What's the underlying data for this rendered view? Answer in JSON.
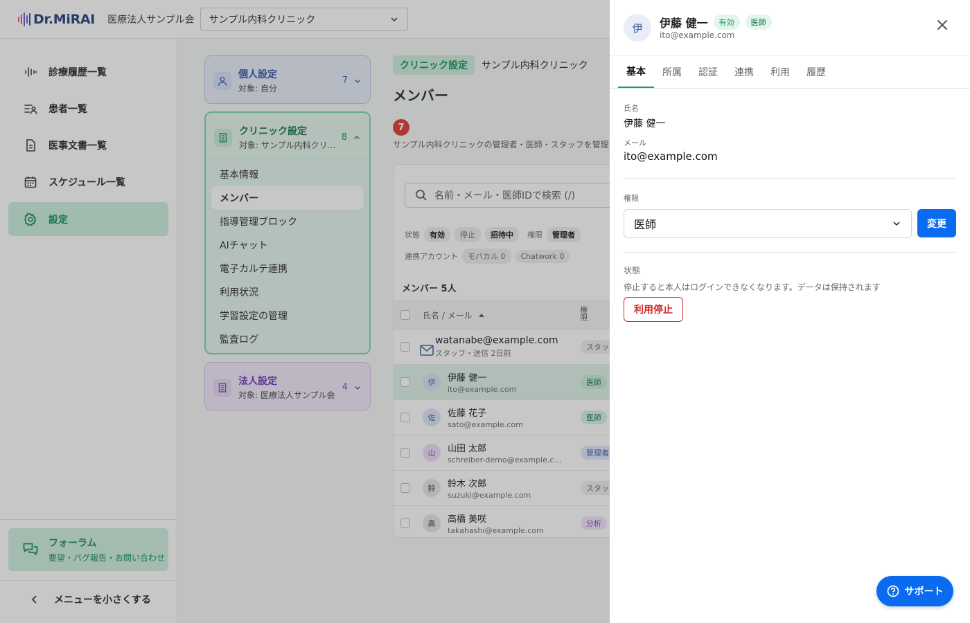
{
  "header": {
    "logo_text": "Dr.MiRAI",
    "org_name": "医療法人サンプル会",
    "clinic_select": "サンプル内科クリニック"
  },
  "sidebar": {
    "items": [
      {
        "label": "診療履歴一覧",
        "icon": "waveform-icon",
        "active": false
      },
      {
        "label": "患者一覧",
        "icon": "patient-list-icon",
        "active": false
      },
      {
        "label": "医事文書一覧",
        "icon": "document-icon",
        "active": false
      },
      {
        "label": "スケジュール一覧",
        "icon": "calendar-icon",
        "active": false
      },
      {
        "label": "設定",
        "icon": "gear-icon",
        "active": true
      }
    ],
    "forum": {
      "title": "フォーラム",
      "subtitle": "要望・バグ報告・お問い合わせ"
    },
    "collapse_label": "メニューを小さくする"
  },
  "settings": {
    "personal": {
      "title": "個人設定",
      "sub": "対象: 自分",
      "count": "7"
    },
    "clinic": {
      "title": "クリニック設定",
      "sub": "対象: サンプル内科クリニック",
      "count": "8",
      "items": [
        "基本情報",
        "メンバー",
        "指導管理ブロック",
        "AIチャット",
        "電子カルテ連携",
        "利用状況",
        "学習設定の管理",
        "監査ログ"
      ]
    },
    "corporate": {
      "title": "法人設定",
      "sub": "対象: 医療法人サンプル会",
      "count": "4"
    }
  },
  "main": {
    "crumb_chip": "クリニック設定",
    "crumb_text": "サンプル内科クリニック",
    "title": "メンバー",
    "badge": "7",
    "description": "サンプル内科クリニックの管理者・医師・スタッフを管理します",
    "search_placeholder": "名前・メール・医師IDで検索 (/)",
    "filters": {
      "status_label": "状態",
      "status": [
        "有効",
        "停止",
        "招待中"
      ],
      "role_label": "権限",
      "role": [
        "管理者"
      ],
      "account_label": "連携アカウント",
      "accounts": [
        "モバカル 0",
        "Chatwork 0"
      ]
    },
    "member_count": "メンバー 5人",
    "columns": {
      "name": "氏名 / メール",
      "role": "権限"
    },
    "invite": {
      "email": "watanabe@example.com",
      "sub": "スタッフ・送信 2日前",
      "role": "スタッフ"
    },
    "members": [
      {
        "initial": "伊",
        "name": "伊藤 健一",
        "email": "ito@example.com",
        "role": "医師",
        "selected": true
      },
      {
        "initial": "佐",
        "name": "佐藤 花子",
        "email": "sato@example.com",
        "role": "医師",
        "selected": false
      },
      {
        "initial": "山",
        "name": "山田 太郎",
        "email": "schreiber-demo@example.com",
        "role": "管理者",
        "selected": false
      },
      {
        "initial": "鈴",
        "name": "鈴木 次郎",
        "email": "suzuki@example.com",
        "role": "スタッフ",
        "selected": false
      },
      {
        "initial": "高",
        "name": "高橋 美咲",
        "email": "takahashi@example.com",
        "role": "分析",
        "selected": false
      }
    ]
  },
  "drawer": {
    "avatar": "伊",
    "name": "伊藤 健一",
    "status_pill": "有効",
    "role_pill": "医師",
    "email": "ito@example.com",
    "tabs": [
      "基本",
      "所属",
      "認証",
      "連携",
      "利用",
      "履歴"
    ],
    "name_label": "氏名",
    "name_value": "伊藤 健一",
    "mail_label": "メール",
    "mail_value": "ito@example.com",
    "role_label": "権限",
    "role_value": "医師",
    "change_button": "変更",
    "status_label": "状態",
    "status_note": "停止すると本人はログインできなくなります。データは保持されます",
    "stop_button": "利用停止",
    "support_button": "サポート"
  },
  "colors": {
    "accent_green": "#0c8a55",
    "primary_blue": "#0b6bf0",
    "danger_red": "#d22a2a"
  }
}
